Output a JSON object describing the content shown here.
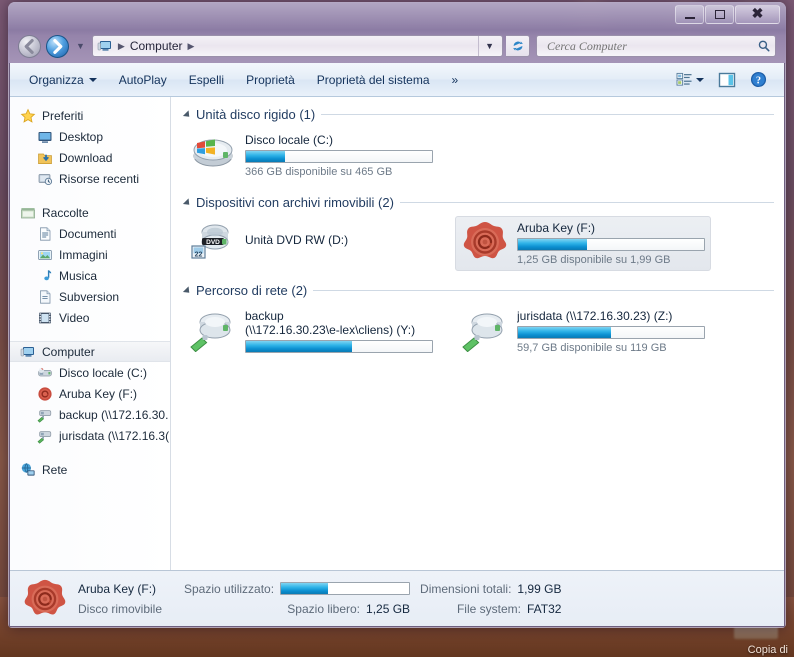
{
  "window": {
    "titlebar_buttons": {
      "minimize": "Riduci a icona",
      "maximize": "Ingrandisci",
      "close": "Chiudi"
    }
  },
  "address_bar": {
    "computer_icon": "computer-icon",
    "crumbs": [
      "Computer"
    ],
    "dropdown_icon": "chevron-down-icon",
    "refresh_icon": "refresh-icon"
  },
  "search": {
    "placeholder": "Cerca Computer",
    "icon": "search-icon",
    "value": ""
  },
  "toolbar": {
    "items": [
      {
        "label": "Organizza",
        "has_caret": true
      },
      {
        "label": "AutoPlay",
        "has_caret": false
      },
      {
        "label": "Espelli",
        "has_caret": false
      },
      {
        "label": "Proprietà",
        "has_caret": false
      },
      {
        "label": "Proprietà del sistema",
        "has_caret": false
      },
      {
        "label": "»",
        "has_caret": false
      }
    ],
    "view_icon": "view-list-icon",
    "view_caret_icon": "chevron-down-icon",
    "preview_icon": "preview-pane-icon",
    "help_icon": "help-icon"
  },
  "sidebar": {
    "groups": [
      {
        "header": {
          "label": "Preferiti",
          "icon": "star-icon"
        },
        "items": [
          {
            "label": "Desktop",
            "icon": "desktop-icon"
          },
          {
            "label": "Download",
            "icon": "download-folder-icon"
          },
          {
            "label": "Risorse recenti",
            "icon": "recent-places-icon"
          }
        ]
      },
      {
        "header": {
          "label": "Raccolte",
          "icon": "libraries-icon"
        },
        "items": [
          {
            "label": "Documenti",
            "icon": "documents-icon"
          },
          {
            "label": "Immagini",
            "icon": "pictures-icon"
          },
          {
            "label": "Musica",
            "icon": "music-icon"
          },
          {
            "label": "Subversion",
            "icon": "subversion-icon"
          },
          {
            "label": "Video",
            "icon": "video-icon"
          }
        ]
      },
      {
        "header": {
          "label": "Computer",
          "icon": "computer-icon",
          "selected": true
        },
        "items": [
          {
            "label": "Disco locale (C:)",
            "icon": "hard-drive-icon"
          },
          {
            "label": "Aruba Key (F:)",
            "icon": "aruba-key-icon"
          },
          {
            "label": "backup (\\\\172.16.30.",
            "icon": "network-drive-icon"
          },
          {
            "label": "jurisdata (\\\\172.16.3(",
            "icon": "network-drive-icon"
          }
        ]
      },
      {
        "header": {
          "label": "Rete",
          "icon": "network-icon"
        },
        "items": []
      }
    ]
  },
  "content": {
    "groups": [
      {
        "title": "Unità disco rigido (1)",
        "items": [
          {
            "name": "Disco locale (C:)",
            "sub": "366 GB disponibile su 465 GB",
            "icon": "hard-drive-windows-icon",
            "has_bar": true,
            "fill_percent": 21,
            "selected": false
          }
        ]
      },
      {
        "title": "Dispositivi con archivi rimovibili (2)",
        "items": [
          {
            "name": "Unità DVD RW (D:)",
            "sub": "",
            "icon": "dvd-drive-icon",
            "has_bar": false,
            "fill_percent": 0,
            "selected": false
          },
          {
            "name": "Aruba Key (F:)",
            "sub": "1,25 GB disponibile su 1,99 GB",
            "icon": "aruba-key-icon",
            "has_bar": true,
            "fill_percent": 37,
            "selected": true
          }
        ]
      },
      {
        "title": "Percorso di rete (2)",
        "items": [
          {
            "name": "backup",
            "name2": "(\\\\172.16.30.23\\e-lex\\cliens) (Y:)",
            "sub": "",
            "icon": "network-drive-icon",
            "has_bar": true,
            "fill_percent": 57,
            "selected": false
          },
          {
            "name": "jurisdata (\\\\172.16.30.23) (Z:)",
            "sub": "59,7 GB disponibile su 119 GB",
            "icon": "network-drive-icon",
            "has_bar": true,
            "fill_percent": 50,
            "selected": false
          }
        ]
      }
    ]
  },
  "details_pane": {
    "icon": "aruba-key-icon",
    "name": "Aruba Key (F:)",
    "type": "Disco rimovibile",
    "used_label": "Spazio utilizzato:",
    "used_fill_percent": 37,
    "free_label": "Spazio libero:",
    "free_value": "1,25 GB",
    "total_label": "Dimensioni totali:",
    "total_value": "1,99 GB",
    "fs_label": "File system:",
    "fs_value": "FAT32"
  },
  "desktop": {
    "label": "Copia di"
  },
  "colors": {
    "accent_blue": "#0b8fd0",
    "glass_purple": "#8b7aa0",
    "toolbar_blue": "#e4edf7",
    "link_text": "#14335c"
  }
}
